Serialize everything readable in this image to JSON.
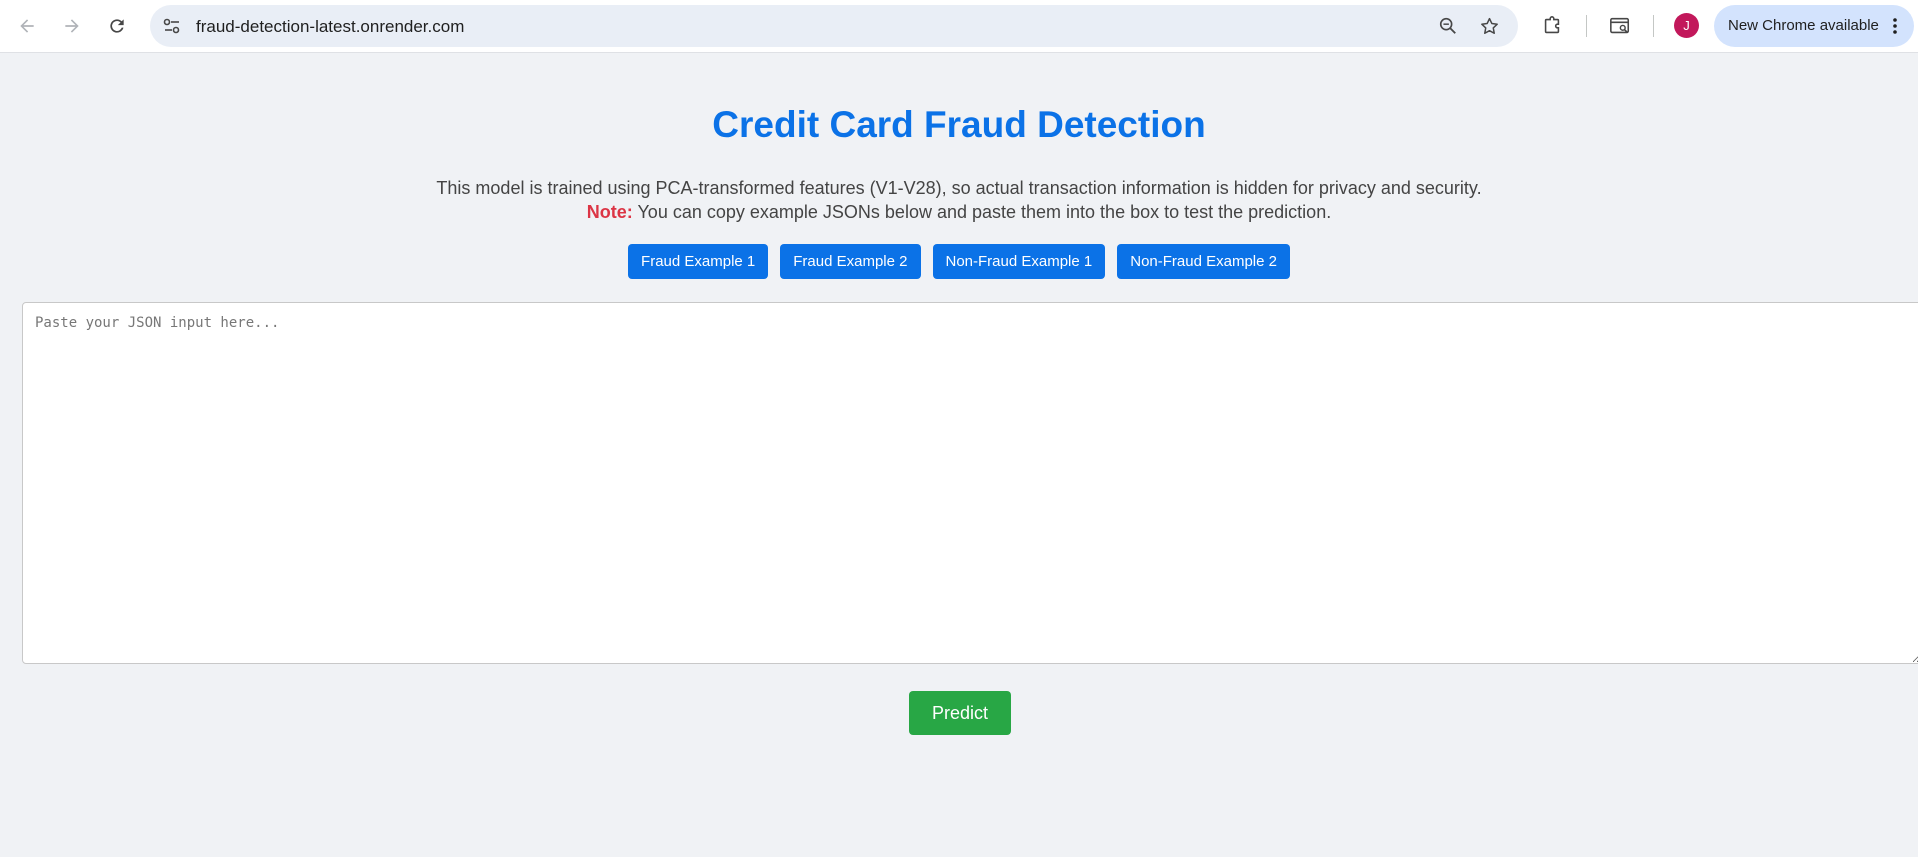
{
  "browser": {
    "url": "fraud-detection-latest.onrender.com",
    "profile_initial": "J",
    "update_label": "New Chrome available",
    "icons": [
      "back-arrow-icon",
      "forward-arrow-icon",
      "reload-icon",
      "site-settings-icon",
      "zoom-icon",
      "bookmark-star-icon",
      "extensions-icon",
      "tab-search-icon",
      "more-vert-icon"
    ]
  },
  "page": {
    "title": "Credit Card Fraud Detection",
    "description": "This model is trained using PCA-transformed features (V1-V28), so actual transaction information is hidden for privacy and security.",
    "note_label": "Note:",
    "note_text": " You can copy example JSONs below and paste them into the box to test the prediction.",
    "examples": {
      "fraud_1": "Fraud Example 1",
      "fraud_2": "Fraud Example 2",
      "nonfraud_1": "Non-Fraud Example 1",
      "nonfraud_2": "Non-Fraud Example 2"
    },
    "input": {
      "placeholder": "Paste your JSON input here...",
      "value": ""
    },
    "predict_label": "Predict"
  },
  "colors": {
    "title_blue": "#0b72e7",
    "button_blue": "#0b72e7",
    "predict_green": "#28a745",
    "note_red": "#dc3545",
    "page_bg": "#f0f2f5"
  }
}
